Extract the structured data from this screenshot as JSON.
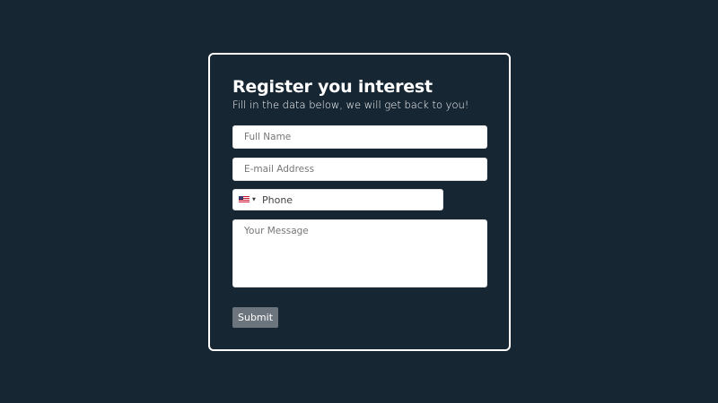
{
  "form": {
    "title": "Register you interest",
    "subtitle": "Fill in the data below, we will get back to you!",
    "full_name": {
      "placeholder": "Full Name",
      "value": ""
    },
    "email": {
      "placeholder": "E-mail Address",
      "value": ""
    },
    "phone": {
      "placeholder": "Phone",
      "value": "",
      "country_flag_icon": "us-flag-icon"
    },
    "message": {
      "placeholder": "Your Message",
      "value": ""
    },
    "submit_label": "Submit"
  },
  "colors": {
    "background": "#172633",
    "card_border": "#ffffff",
    "submit_bg": "#6c757d"
  }
}
